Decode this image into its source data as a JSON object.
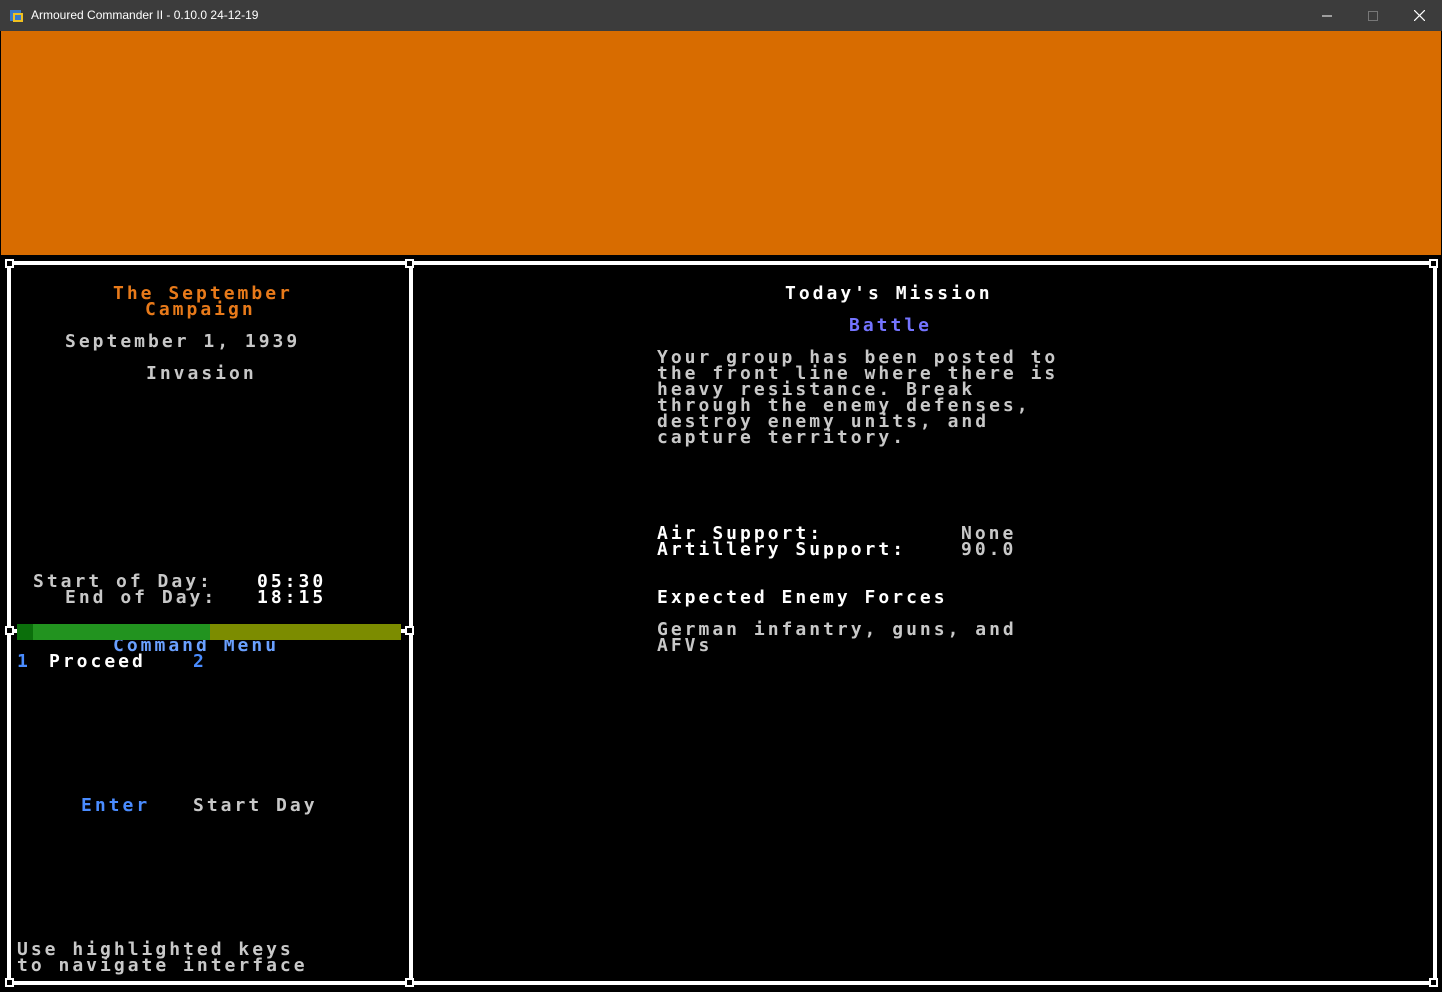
{
  "window": {
    "title": "Armoured Commander II - 0.10.0 24-12-19"
  },
  "colors": {
    "banner": "#d86c00",
    "campaign_title": "#e87a1a",
    "mission_type": "#7474ff",
    "menu_highlight": "#22931f",
    "menu_row": "#7c8c00"
  },
  "campaign": {
    "title_line1": "The September",
    "title_line2": "Campaign",
    "date": "September 1, 1939",
    "phase": "Invasion",
    "start_label": "Start of Day:",
    "start_time": "05:30",
    "end_label": "End of Day:",
    "end_time": "18:15"
  },
  "command_menu": {
    "title": "Command Menu",
    "items": [
      {
        "key": "1",
        "label": "Proceed"
      },
      {
        "key": "2",
        "label": ""
      }
    ],
    "action_key": "Enter",
    "action_label": "Start Day",
    "hint_line1": "Use highlighted keys",
    "hint_line2": "to navigate interface"
  },
  "mission": {
    "heading": "Today's Mission",
    "type": "Battle",
    "description_lines": [
      "Your group has been posted to",
      "the front line where there is",
      "heavy resistance. Break",
      "through the enemy defenses,",
      "destroy enemy units, and",
      "capture territory."
    ],
    "air_support_label": "Air Support:",
    "air_support_value": "None",
    "artillery_support_label": "Artillery Support:",
    "artillery_support_value": "90.0",
    "enemy_heading": "Expected Enemy Forces",
    "enemy_lines": [
      "German infantry, guns, and",
      "AFVs"
    ]
  }
}
